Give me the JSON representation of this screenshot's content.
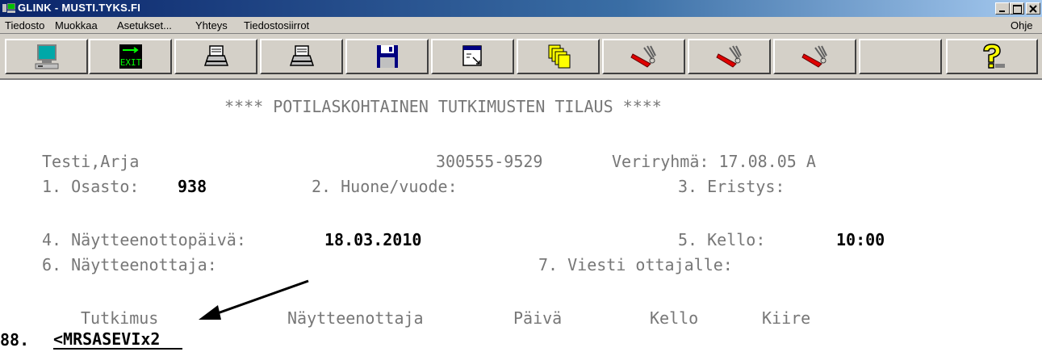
{
  "window": {
    "title": "GLINK - MUSTI.TYKS.FI"
  },
  "menu": {
    "items": [
      "Tiedosto",
      "Muokkaa",
      "Asetukset...",
      "Yhteys",
      "Tiedostosiirrot"
    ],
    "help": "Ohje"
  },
  "toolbar": {
    "buttons": [
      {
        "icon": "computer-icon"
      },
      {
        "icon": "exit-icon",
        "label": "EXIT"
      },
      {
        "icon": "printer-icon"
      },
      {
        "icon": "printer-icon"
      },
      {
        "icon": "floppy-disk-icon"
      },
      {
        "icon": "window-icon"
      },
      {
        "icon": "stacked-pages-icon"
      },
      {
        "icon": "swiss-knife-icon"
      },
      {
        "icon": "swiss-knife-icon"
      },
      {
        "icon": "swiss-knife-icon"
      },
      {
        "icon": "help-icon"
      }
    ]
  },
  "screen": {
    "header": "**** POTILASKOHTAINEN TUTKIMUSTEN TILAUS ****",
    "patient_name": "Testi,Arja",
    "patient_id": "300555-9529",
    "blood_group": "Veriryhmä: 17.08.05 A",
    "osasto_label": "1. Osasto:",
    "osasto_value": "938",
    "huone_label": "2. Huone/vuode:",
    "eristys_label": "3. Eristys:",
    "nayttpaiva_label": "4. Näytteenottopäivä:",
    "nayttpaiva_value": "18.03.2010",
    "kello_label": "5. Kello:",
    "kello_value": "10:00",
    "naytteenottaja_label": "6. Näytteenottaja:",
    "viesti_label": "7. Viesti ottajalle:",
    "columns": [
      "Tutkimus",
      "Näytteenottaja",
      "Päivä",
      "Kello",
      "Kiire"
    ],
    "row_number": "88.",
    "input_value": "<MRSASEVIx2"
  }
}
